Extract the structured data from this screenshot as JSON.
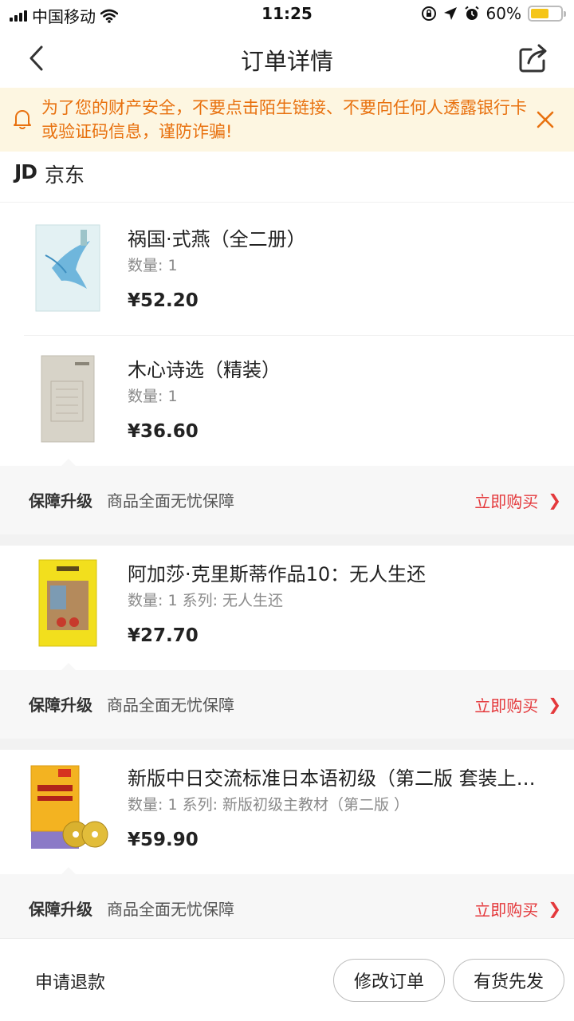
{
  "status_bar": {
    "carrier": "中国移动",
    "time": "11:25",
    "battery": "60%",
    "battery_level": 0.6
  },
  "nav": {
    "title": "订单详情",
    "back_icon": "chevron-left-icon",
    "share_icon": "share-icon"
  },
  "banner": {
    "text": "为了您的财产安全，不要点击陌生链接、不要向任何人透露银行卡或验证码信息，谨防诈骗!",
    "bell_icon": "bell-icon",
    "close_icon": "close-icon",
    "color": "#e8710f",
    "background": "#fdf6e1"
  },
  "shop": {
    "logo": "JD",
    "name": "京东"
  },
  "products": [
    {
      "title": "祸国·式燕（全二册）",
      "meta": "数量: 1",
      "price": "¥52.20"
    },
    {
      "title": "木心诗选（精装）",
      "meta": "数量: 1",
      "price": "¥36.60"
    },
    {
      "title": "阿加莎·克里斯蒂作品10：无人生还",
      "meta": "数量: 1 系列: 无人生还",
      "price": "¥27.70"
    },
    {
      "title": "新版中日交流标准日本语初级（第二版 套装上…",
      "meta": "数量: 1 系列: 新版初级主教材（第二版 ）",
      "price": "¥59.90"
    }
  ],
  "protection": {
    "label": "保障升级",
    "desc": "商品全面无忧保障",
    "action": "立即购买",
    "arrow": "❯",
    "accent": "#e4393c"
  },
  "footer": {
    "refund": "申请退款",
    "modify": "修改订单",
    "in_stock": "有货先发"
  }
}
